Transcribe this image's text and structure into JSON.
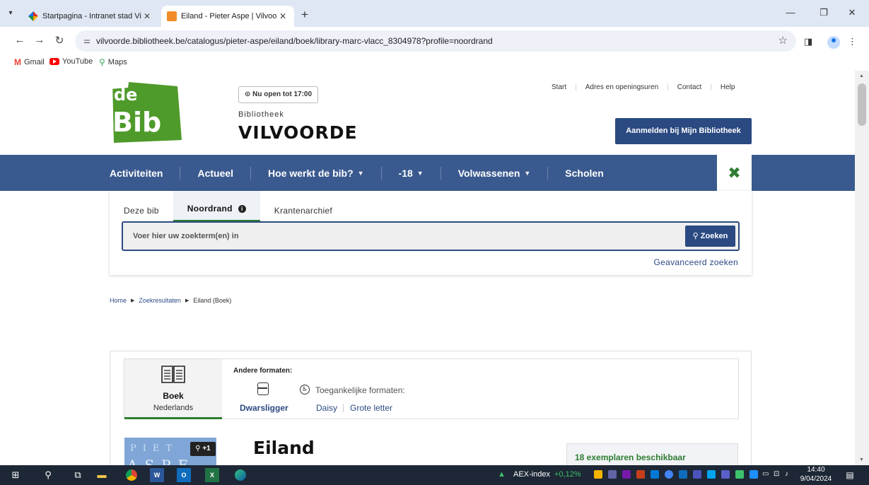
{
  "browser": {
    "tabs": [
      {
        "title": "Startpagina - Intranet stad Vilvo",
        "close": "✕"
      },
      {
        "title": "Eiland - Pieter Aspe | Vilvoorde",
        "close": "✕"
      }
    ],
    "new_tab": "+",
    "url": "vilvoorde.bibliotheek.be/catalogus/pieter-aspe/eiland/boek/library-marc-vlacc_8304978?profile=noordrand",
    "bookmarks": [
      "Gmail",
      "YouTube",
      "Maps"
    ]
  },
  "header": {
    "logo_text_top": "de",
    "logo_text_bottom": "Bib",
    "open_status": "⊙ Nu open tot 17:00",
    "library_label": "Bibliotheek",
    "library_name": "VILVOORDE",
    "top_links": [
      "Start",
      "Adres en openingsuren",
      "Contact",
      "Help"
    ],
    "login_button": "Aanmelden bij Mijn Bibliotheek"
  },
  "main_nav": {
    "items": [
      "Activiteiten",
      "Actueel",
      "Hoe werkt de bib?",
      "-18",
      "Volwassenen",
      "Scholen"
    ],
    "close_symbol": "✖"
  },
  "search": {
    "tabs": [
      "Deze bib",
      "Noordrand",
      "Krantenarchief"
    ],
    "active_tab": "Noordrand",
    "placeholder": "Voer hier uw zoekterm(en) in",
    "button": "Zoeken",
    "advanced_link": "Geavanceerd zoeken"
  },
  "breadcrumb": [
    "Home",
    "Zoekresultaten",
    "Eiland (Boek)"
  ],
  "detail": {
    "current_format": {
      "title": "Boek",
      "language": "Nederlands"
    },
    "other_formats_label": "Andere formaten:",
    "other_format_link": "Dwarsligger",
    "accessible_label": "Toegankelijke formaten:",
    "accessible_links": [
      "Daisy",
      "Grote letter"
    ],
    "cover_author": "PIET",
    "cover_big": "ASPE",
    "zoom_badge": "+1",
    "title": "Eiland",
    "availability": "18 exemplaren beschikbaar"
  },
  "taskbar": {
    "stock_name": "AEX-index",
    "stock_change": "+0,12%",
    "time": "14:40",
    "date": "9/04/2024"
  },
  "colors": {
    "nav_blue": "#3a5a8f",
    "button_blue": "#2b4a82",
    "bib_green": "#4e9a2a",
    "accent_green": "#2e7d32"
  }
}
